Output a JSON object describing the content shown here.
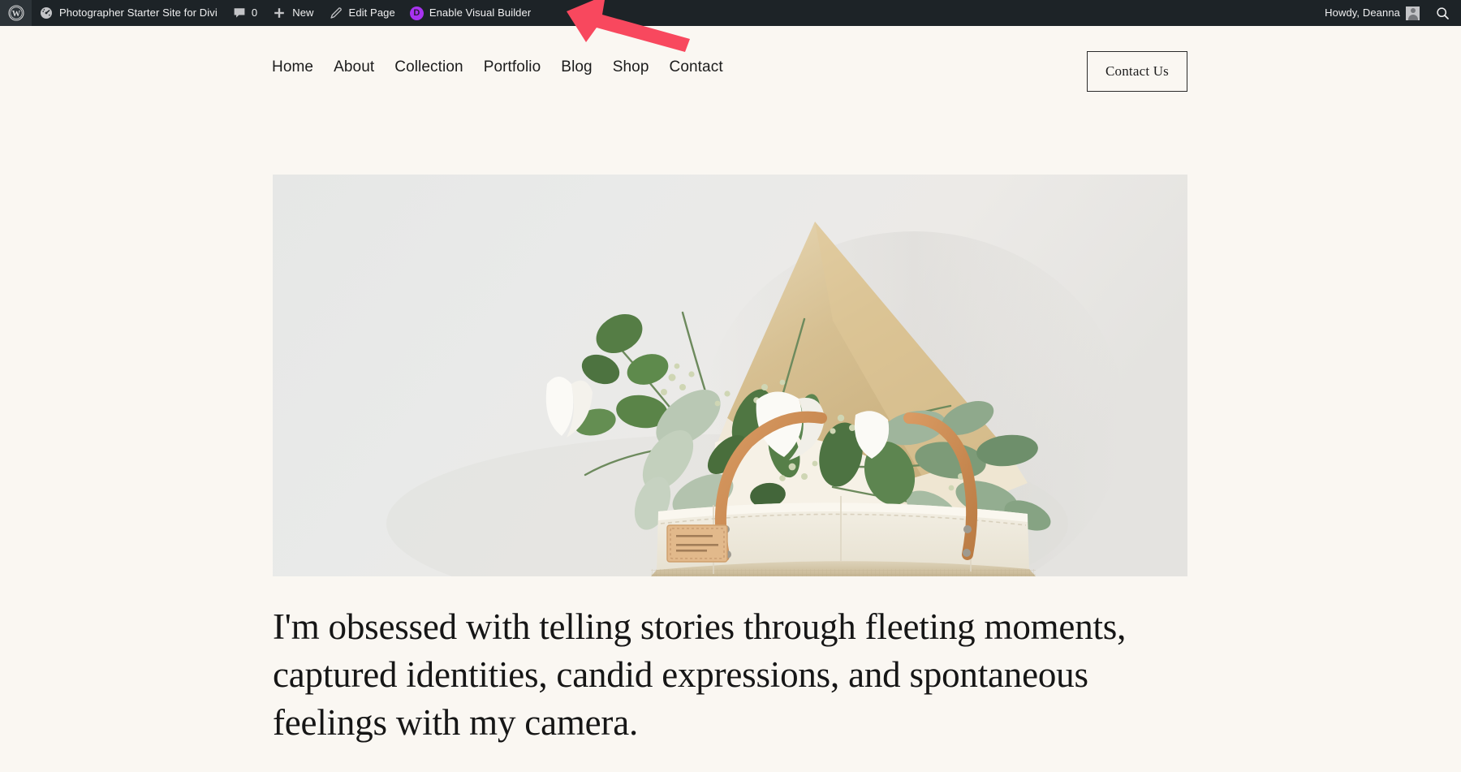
{
  "admin_bar": {
    "wp_logo_icon": "wordpress-logo-icon",
    "site_name": "Photographer Starter Site for Divi",
    "site_icon": "dashboard-speedometer-icon",
    "comments": {
      "icon": "comment-bubble-icon",
      "count": "0"
    },
    "new": {
      "icon": "plus-icon",
      "label": "New"
    },
    "edit_page": {
      "icon": "pencil-icon",
      "label": "Edit Page"
    },
    "visual_builder": {
      "badge": "D",
      "badge_color": "#a833f0",
      "label": "Enable Visual Builder"
    },
    "account": {
      "greeting": "Howdy, Deanna",
      "avatar_icon": "avatar-icon"
    },
    "search_icon": "search-icon",
    "background_color": "#1d2327",
    "text_color": "#f0f0f1"
  },
  "site": {
    "background_color": "#faf7f2",
    "nav": [
      {
        "label": "Home"
      },
      {
        "label": "About"
      },
      {
        "label": "Collection"
      },
      {
        "label": "Portfolio"
      },
      {
        "label": "Blog"
      },
      {
        "label": "Shop"
      },
      {
        "label": "Contact"
      }
    ],
    "cta_button": {
      "label": "Contact Us"
    },
    "hero": {
      "image_alt": "Jute tote bag holding a kraft-paper wrapped bouquet of white tulips and eucalyptus against a pale wall",
      "headline": "I'm obsessed with telling stories through fleeting moments, captured identities, candid expressions, and spontaneous feelings with my camera."
    }
  },
  "annotation": {
    "type": "arrow",
    "direction": "left",
    "color": "#f8485e",
    "points_to": "Enable Visual Builder"
  }
}
